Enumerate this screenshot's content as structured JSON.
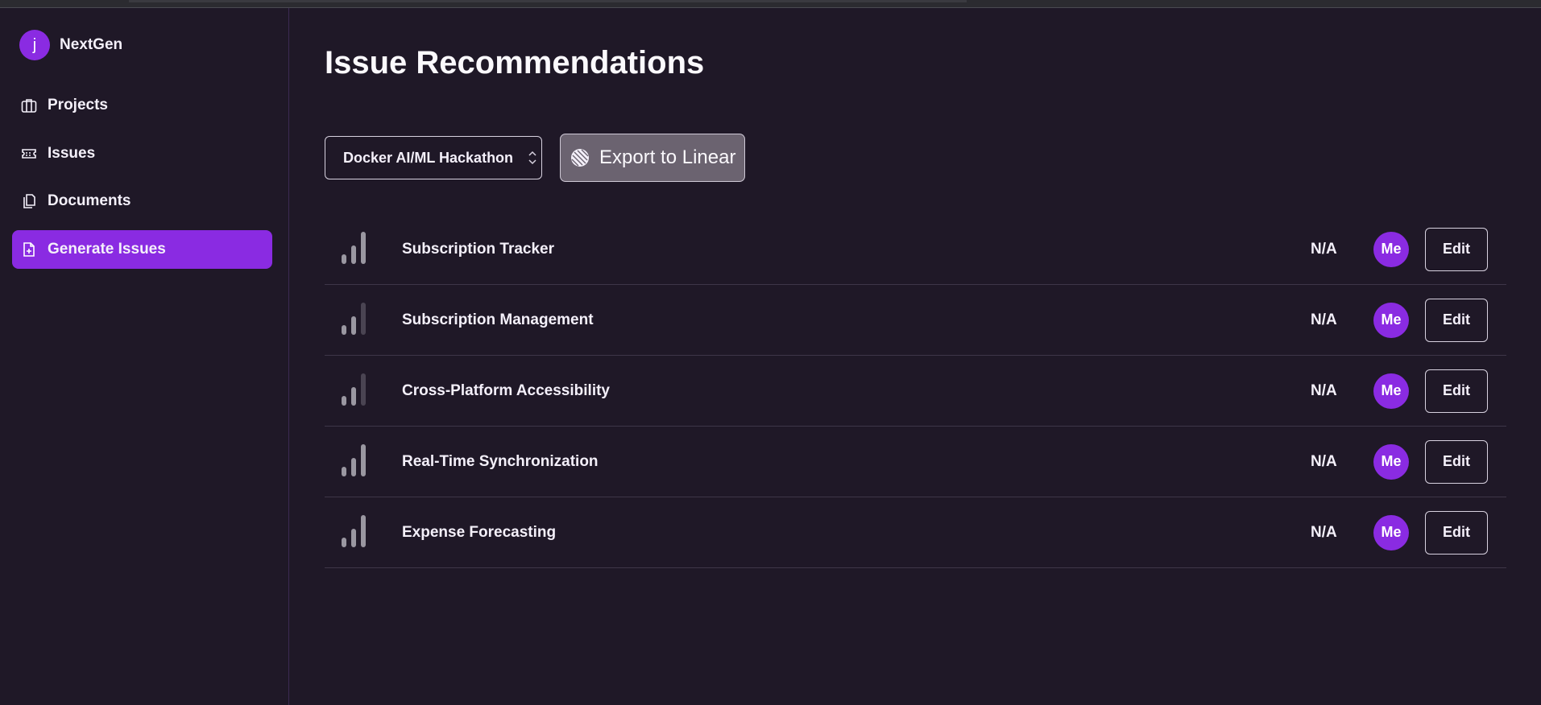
{
  "brand": {
    "avatar_letter": "j",
    "name": "NextGen"
  },
  "sidebar": {
    "items": [
      {
        "label": "Projects",
        "icon": "briefcase-icon",
        "active": false
      },
      {
        "label": "Issues",
        "icon": "ticket-icon",
        "active": false
      },
      {
        "label": "Documents",
        "icon": "documents-icon",
        "active": false
      },
      {
        "label": "Generate Issues",
        "icon": "file-plus-icon",
        "active": true
      }
    ]
  },
  "main": {
    "title": "Issue Recommendations",
    "project_select": {
      "value": "Docker AI/ML Hackathon",
      "icon": "chevron-updown-icon"
    },
    "export_button": {
      "label": "Export to Linear",
      "icon": "linear-logo-icon"
    }
  },
  "issues": [
    {
      "title": "Subscription Tracker",
      "status": "N/A",
      "assignee": "Me",
      "edit_label": "Edit",
      "priority_level": 3
    },
    {
      "title": "Subscription Management",
      "status": "N/A",
      "assignee": "Me",
      "edit_label": "Edit",
      "priority_level": 2
    },
    {
      "title": "Cross-Platform Accessibility",
      "status": "N/A",
      "assignee": "Me",
      "edit_label": "Edit",
      "priority_level": 2
    },
    {
      "title": "Real-Time Synchronization",
      "status": "N/A",
      "assignee": "Me",
      "edit_label": "Edit",
      "priority_level": 3
    },
    {
      "title": "Expense Forecasting",
      "status": "N/A",
      "assignee": "Me",
      "edit_label": "Edit",
      "priority_level": 3
    }
  ],
  "colors": {
    "background": "#1f1827",
    "accent": "#8a2be2",
    "priority_on": "#9a97a1",
    "priority_off": "#4a4452"
  }
}
